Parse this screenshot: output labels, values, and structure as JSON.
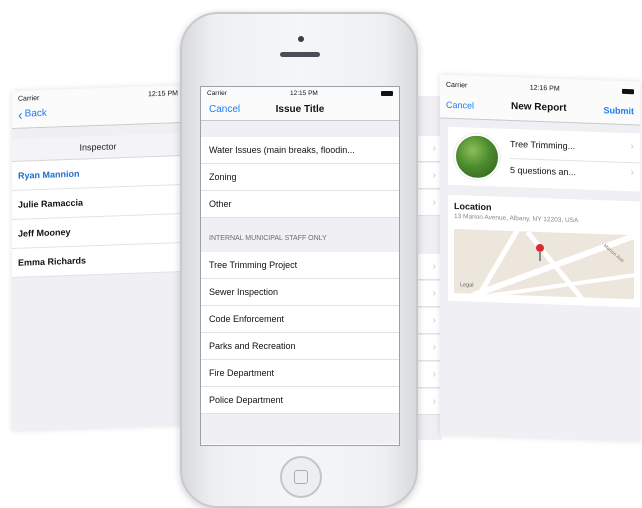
{
  "left_screen": {
    "status_carrier": "Carrier",
    "status_time": "12:15 PM",
    "back_label": "Back",
    "section_header": "Inspector",
    "inspectors": [
      "Ryan Mannion",
      "Julie Ramaccia",
      "Jeff Mooney",
      "Emma Richards"
    ],
    "selected_index": 0
  },
  "main_screen": {
    "status_carrier": "Carrier",
    "status_time": "12:15 PM",
    "cancel_label": "Cancel",
    "title": "Issue Title",
    "top_items": [
      "Water Issues (main breaks, floodin...",
      "Zoning",
      "Other"
    ],
    "section_label": "INTERNAL MUNICIPAL STAFF ONLY",
    "staff_items": [
      "Tree Trimming Project",
      "Sewer Inspection",
      "Code Enforcement",
      "Parks and Recreation",
      "Fire Department",
      "Police Department"
    ]
  },
  "right_screen": {
    "status_carrier": "Carrier",
    "status_time": "12:16 PM",
    "cancel_label": "Cancel",
    "title": "New Report",
    "submit_label": "Submit",
    "card_title": "Tree Trimming...",
    "card_subtitle": "5 questions an...",
    "location_label": "Location",
    "location_address": "13 Marion Avenue, Albany, NY 12203, USA",
    "map_legal": "Legal",
    "map_street": "Marion Ave"
  },
  "icons": {
    "chevron": "›",
    "back_chevron": "‹",
    "wifi": "ᯤ"
  },
  "colors": {
    "accent": "#1a7cf5",
    "background": "#efeff4",
    "pin": "#e0282f"
  }
}
